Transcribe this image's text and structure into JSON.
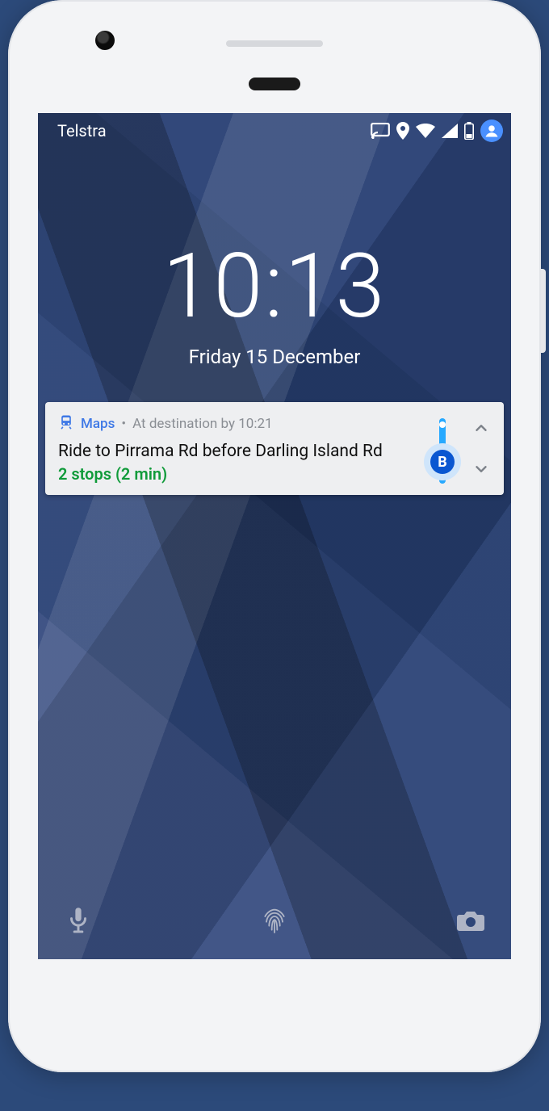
{
  "status": {
    "carrier": "Telstra"
  },
  "clock": {
    "time": "10:13",
    "date": "Friday 15 December"
  },
  "notification": {
    "app": "Maps",
    "separator": "•",
    "subtitle": "At destination by 10:21",
    "title": "Ride to Pirrama Rd before Darling Island Rd",
    "detail": "2 stops (2 min)",
    "badge": "B"
  }
}
